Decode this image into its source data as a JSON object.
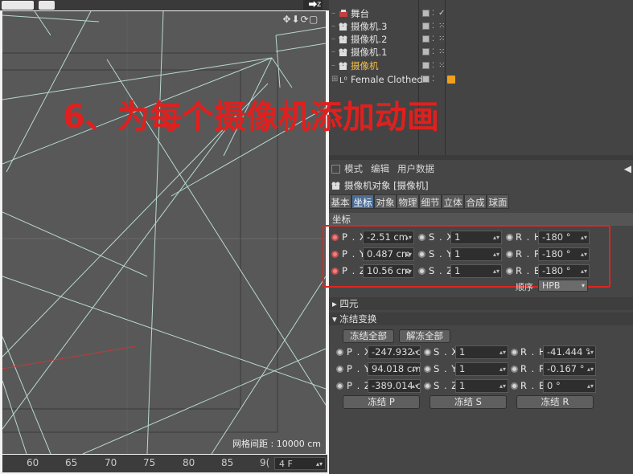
{
  "viewport": {
    "grid_distance": "网格间距 : 10000 cm",
    "timeline_ticks": [
      "60",
      "65",
      "70",
      "75",
      "80",
      "85",
      "9("
    ],
    "frame_field": "4 F"
  },
  "overlay_title": "6、为每个摄像机添加动画",
  "object_manager": {
    "objects": [
      {
        "name": "舞台",
        "tag": "✓"
      },
      {
        "name": "摄像机.3",
        "tag": ""
      },
      {
        "name": "摄像机.2",
        "tag": ""
      },
      {
        "name": "摄像机.1",
        "tag": ""
      },
      {
        "name": "摄像机",
        "tag": ""
      },
      {
        "name": "Female Clothed",
        "tag": ""
      }
    ]
  },
  "attributes": {
    "menu": [
      "模式",
      "编辑",
      "用户数据"
    ],
    "object_title": "摄像机对象 [摄像机]",
    "tabs": [
      "基本",
      "坐标",
      "对象",
      "物理",
      "细节",
      "立体",
      "合成",
      "球面"
    ],
    "active_tab": "坐标",
    "coord_section": "坐标",
    "coords": [
      {
        "p_label": "P . X",
        "p_value": "-2.51 cm",
        "s_label": "S . X",
        "s_value": "1",
        "r_label": "R . H",
        "r_value": "-180 °"
      },
      {
        "p_label": "P . Y",
        "p_value": "0.487 cm",
        "s_label": "S . Y",
        "s_value": "1",
        "r_label": "R . P",
        "r_value": "-180 °"
      },
      {
        "p_label": "P . Z",
        "p_value": "10.56 cm",
        "s_label": "S . Z",
        "s_value": "1",
        "r_label": "R . B",
        "r_value": "-180 °"
      }
    ],
    "order_label": "顺序",
    "order_value": "HPB",
    "quaternion_section": "▸ 四元",
    "freeze_section": "▾ 冻结变换",
    "freeze_all": "冻结全部",
    "unfreeze_all": "解冻全部",
    "frozen_coords": [
      {
        "p_label": "P . X",
        "p_value": "-247.932 c",
        "s_label": "S . X",
        "s_value": "1",
        "r_label": "R . H",
        "r_value": "-41.444 °"
      },
      {
        "p_label": "P . Y",
        "p_value": "94.018 cm",
        "s_label": "S . Y",
        "s_value": "1",
        "r_label": "R . P",
        "r_value": "-0.167 °"
      },
      {
        "p_label": "P . Z",
        "p_value": "-389.014 c",
        "s_label": "S . Z",
        "s_value": "1",
        "r_label": "R . B",
        "r_value": "0 °"
      }
    ],
    "freeze_p": "冻结 P",
    "freeze_s": "冻结 S",
    "freeze_r": "冻结 R"
  },
  "colors": {
    "selected_object": "#f3c04a",
    "overlay_text": "#e0201e",
    "highlight_box": "#e0241f",
    "active_tab": "#4b6d96"
  }
}
